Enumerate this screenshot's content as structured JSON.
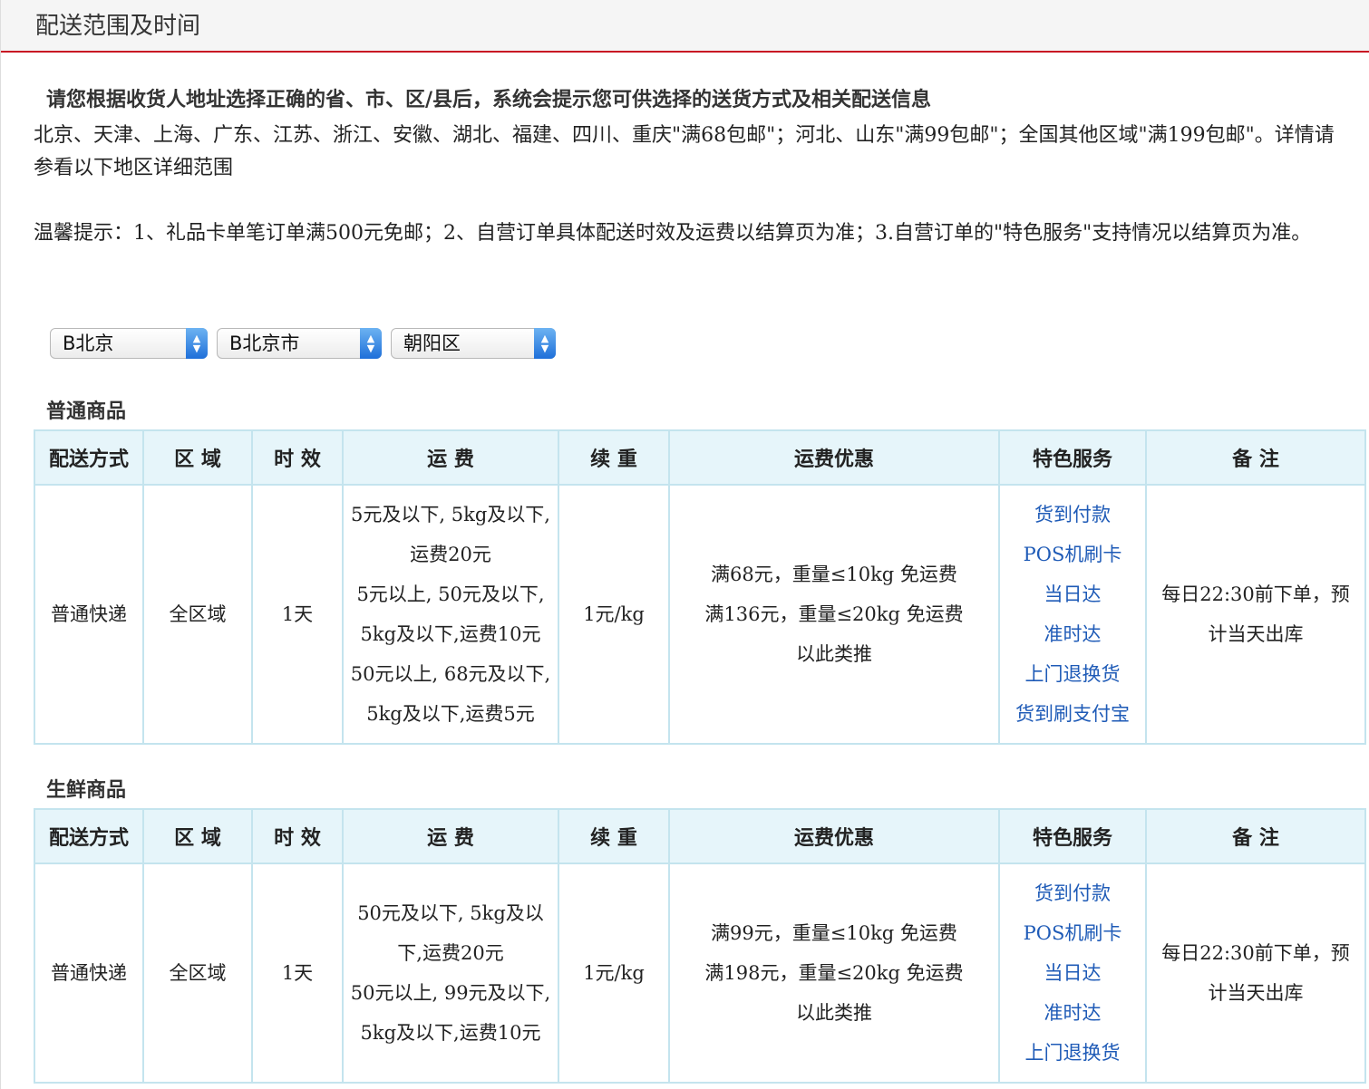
{
  "header": {
    "title": "配送范围及时间"
  },
  "intro": "请您根据收货人地址选择正确的省、市、区/县后，系统会提示您可供选择的送货方式及相关配送信息",
  "policy": "北京、天津、上海、广东、江苏、浙江、安徽、湖北、福建、四川、重庆\"满68包邮\"；河北、山东\"满99包邮\"；全国其他区域\"满199包邮\"。详情请参看以下地区详细范围",
  "tips": "温馨提示：1、礼品卡单笔订单满500元免邮；2、自营订单具体配送时效及运费以结算页为准；3.自营订单的\"特色服务\"支持情况以结算页为准。",
  "selects": {
    "province": "B北京",
    "city": "B北京市",
    "district": "朝阳区"
  },
  "columns": [
    "配送方式",
    "区 域",
    "时 效",
    "运 费",
    "续 重",
    "运费优惠",
    "特色服务",
    "备 注"
  ],
  "sections": [
    {
      "title": "普通商品",
      "row": {
        "method": "普通快递",
        "area": "全区域",
        "time": "1天",
        "fee": [
          "5元及以下, 5kg及以下,",
          "运费20元",
          "5元以上, 50元及以下,",
          "5kg及以下,运费10元",
          "50元以上, 68元及以下,",
          "5kg及以下,运费5元"
        ],
        "extra_weight": "1元/kg",
        "discount": [
          "满68元，重量≤10kg 免运费",
          "满136元，重量≤20kg 免运费",
          "以此类推"
        ],
        "services": [
          "货到付款",
          "POS机刷卡",
          "当日达",
          "准时达",
          "上门退换货",
          "货到刷支付宝"
        ],
        "note": [
          "每日22:30前下单，预",
          "计当天出库"
        ]
      }
    },
    {
      "title": "生鲜商品",
      "row": {
        "method": "普通快递",
        "area": "全区域",
        "time": "1天",
        "fee": [
          "50元及以下, 5kg及以",
          "下,运费20元",
          "50元以上, 99元及以下,",
          "5kg及以下,运费10元"
        ],
        "extra_weight": "1元/kg",
        "discount": [
          "满99元，重量≤10kg 免运费",
          "满198元，重量≤20kg 免运费",
          "以此类推"
        ],
        "services": [
          "货到付款",
          "POS机刷卡",
          "当日达",
          "准时达",
          "上门退换货"
        ],
        "note": [
          "每日22:30前下单，预",
          "计当天出库"
        ]
      }
    }
  ]
}
